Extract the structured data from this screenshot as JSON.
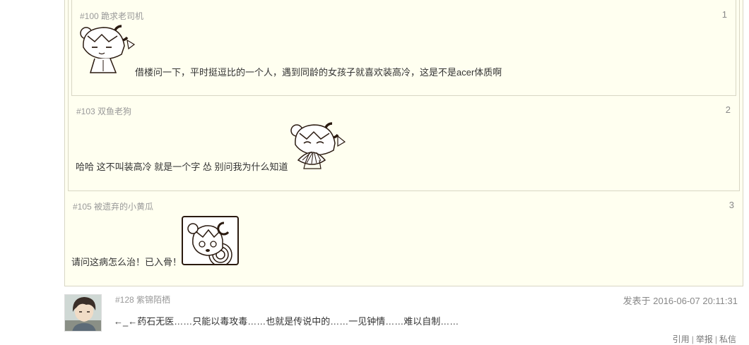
{
  "quotes": [
    {
      "header": "#105 被遗弃的小黄瓜",
      "floor": "3",
      "text": "请问这病怎么治！已入骨！"
    },
    {
      "header": "#103 双鱼老狗",
      "floor": "2",
      "text": "哈哈 这不叫装高冷 就是一个字 怂 别问我为什么知道"
    },
    {
      "header": "#100 跪求老司机",
      "floor": "1",
      "text": "借楼问一下，平时挺逗比的一个人，遇到同龄的女孩子就喜欢装高冷，这是不是acer体质啊"
    }
  ],
  "post": {
    "header": "#128 紫锦陌栖",
    "time": "发表于 2016-06-07 20:11:31",
    "text": "←_←药石无医……只能以毒攻毒……也就是传说中的……一见钟情……难以自制……",
    "actions": {
      "quote": "引用",
      "sep1": "|",
      "report": "举报",
      "sep2": "|",
      "message": "私信"
    }
  },
  "colors": {
    "quote_bg": "#fffff0",
    "quote_border": "#d8d6c4",
    "meta_text": "#999999"
  },
  "icons": {
    "sticker_1": "chibi-girl-sticker-icon",
    "sticker_2": "chibi-girl-fan-sticker-icon",
    "sticker_3": "chibi-girl-dizzy-sticker-icon",
    "avatar": "user-avatar-icon"
  }
}
